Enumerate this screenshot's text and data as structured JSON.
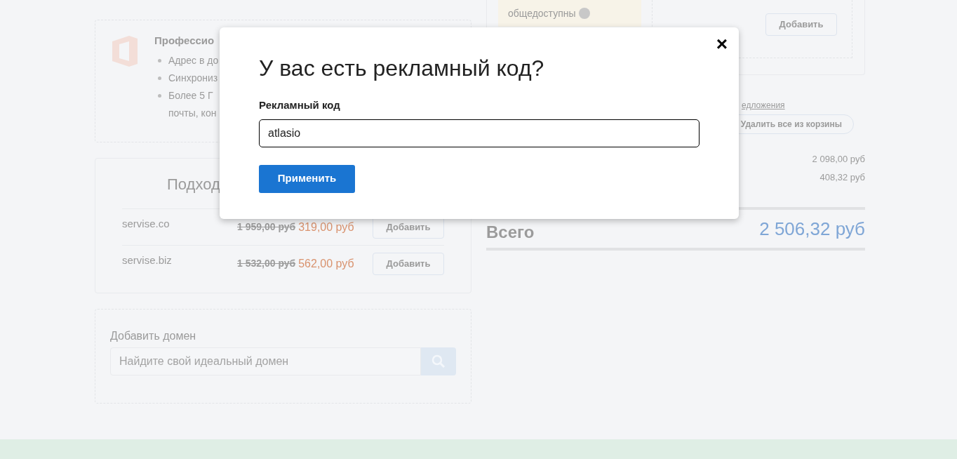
{
  "page": {
    "plan_card": {
      "title": "Профессио",
      "features": [
        "Адрес в до",
        "Синхрониз",
        "Более 5 Г",
        "почты, кон"
      ]
    },
    "suggestions": {
      "title": "Подход",
      "rows": [
        {
          "domain": "servise.co",
          "old_price": "1 959,00 руб",
          "price": "319,00 руб",
          "button": "Добавить"
        },
        {
          "domain": "servise.biz",
          "old_price": "1 532,00 руб",
          "price": "562,00 руб",
          "button": "Добавить"
        }
      ]
    },
    "add_domain": {
      "label": "Добавить домен",
      "placeholder": "Найдите свой идеальный домен"
    },
    "cart": {
      "note": "общедоступны",
      "addon_button": "Добавить",
      "offers_link": "едложения",
      "clear_button": "Удалить все из корзины",
      "lines": [
        "2 098,00 руб",
        "408,32 руб"
      ],
      "total": {
        "label": "Всего",
        "value": "2 506,32 руб"
      }
    }
  },
  "modal": {
    "title": "У вас есть рекламный код?",
    "close": "×",
    "field_label": "Рекламный код",
    "field_value": "atlasio",
    "apply_button": "Применить"
  }
}
